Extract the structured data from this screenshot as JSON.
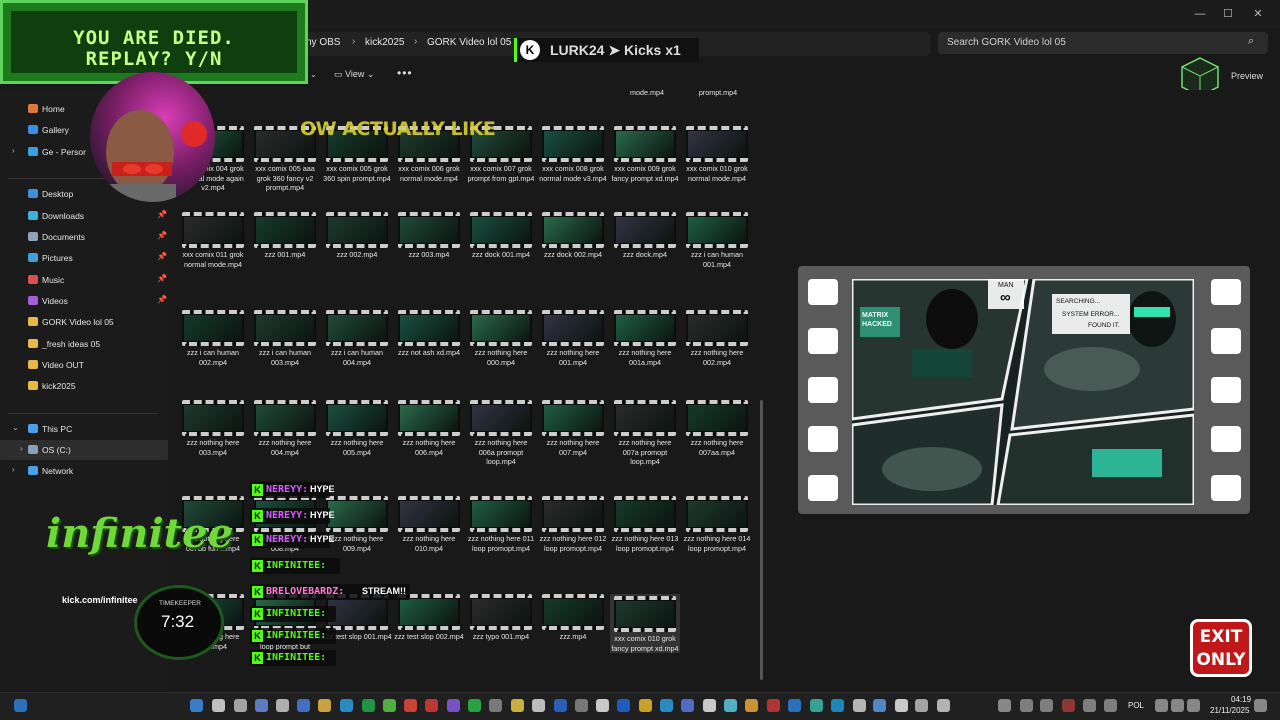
{
  "window": {
    "minimize": "—",
    "maximize": "☐",
    "close": "✕"
  },
  "address": {
    "crumbs": [
      "ny OBS",
      "kick2025",
      "GORK Video lol 05"
    ],
    "separator": "›"
  },
  "search": {
    "placeholder": "Search GORK Video lol 05"
  },
  "toolbar": {
    "view_label": "View",
    "more_label": "•••",
    "preview_label": "Preview"
  },
  "sidebar": {
    "items": [
      {
        "label": "Home",
        "color": "#e07a3c"
      },
      {
        "label": "Gallery",
        "color": "#3c8ee0"
      },
      {
        "label": "Ge - Persor",
        "color": "#3c9ee0"
      },
      {
        "label": "Desktop",
        "color": "#3f8fd9"
      },
      {
        "label": "Downloads",
        "color": "#3fb0d9"
      },
      {
        "label": "Documents",
        "color": "#8fa3b8"
      },
      {
        "label": "Pictures",
        "color": "#3fa0d9"
      },
      {
        "label": "Music",
        "color": "#d95050"
      },
      {
        "label": "Videos",
        "color": "#a75fd9"
      },
      {
        "label": "GORK Video lol 05",
        "color": "#e8b84a"
      },
      {
        "label": "_fresh ideas 05",
        "color": "#e8b84a"
      },
      {
        "label": "Video OUT",
        "color": "#e8b84a"
      },
      {
        "label": "kick2025",
        "color": "#e8b84a"
      },
      {
        "label": "This PC",
        "color": "#4aa0e8"
      },
      {
        "label": "OS (C:)",
        "color": "#8aa0b8"
      },
      {
        "label": "Network",
        "color": "#4aa0e8"
      }
    ]
  },
  "files": {
    "top_cut": [
      "mode.mp4",
      "prompt.mp4"
    ],
    "rows": [
      [
        "xxx comix 004 grok normal mode again v2.mp4",
        "xxx comix 005 aaa grok 360 fancy v2 prompt.mp4",
        "xxx comix 005 grok 360 spin prompt.mp4",
        "xxx comix 006 grok normal mode.mp4",
        "xxx comix 007 grok prompt from gpt.mp4",
        "xxx comix 008 grok normal mode v3.mp4",
        "xxx comix 009 grok fancy prompt xd.mp4",
        "xxx comix 010 grok normal mode.mp4"
      ],
      [
        "xxx comix 011 grok normal mode.mp4",
        "zzz 001.mp4",
        "zzz 002.mp4",
        "zzz 003.mp4",
        "zzz dock 001.mp4",
        "zzz dock 002.mp4",
        "zzz dock.mp4",
        "zzz i can human 001.mp4"
      ],
      [
        "zzz i can human 002.mp4",
        "zzz i can human 003.mp4",
        "zzz i can human 004.mp4",
        "zzz not ash xd.mp4",
        "zzz nothing here 000.mp4",
        "zzz nothing here 001.mp4",
        "zzz nothing here 001a.mp4",
        "zzz nothing here 002.mp4"
      ],
      [
        "zzz nothing here 003.mp4",
        "zzz nothing here 004.mp4",
        "zzz nothing here 005.mp4",
        "zzz nothing here 006.mp4",
        "zzz nothing here 006a promopt loop.mp4",
        "zzz nothing here 007.mp4",
        "zzz nothing here 007a promopt loop.mp4",
        "zzz nothing here 007aa.mp4"
      ],
      [
        "zzz nothing here 007bb fun ...mp4",
        "zzz nothing here 008.mp4",
        "zzz nothing here 009.mp4",
        "zzz nothing here 010.mp4",
        "zzz nothing here 011 loop promopt.mp4",
        "zzz nothing here 012 loop promopt.mp4",
        "zzz nothing here 013 loop promopt.mp4",
        "zzz nothing here 014 loop promopt.mp4"
      ],
      [
        "zzz nothing here 015.mp4",
        "zzz nothing here 016 loop prompt but",
        "zzz test slop 001.mp4",
        "zzz test slop 002.mp4",
        "zzz typo 001.mp4",
        "zzz.mp4",
        "xxx comix 010 grok fancy prompt xd.mp4",
        ""
      ]
    ]
  },
  "overlay": {
    "game_line1": "YOU ARE DIED.",
    "game_line2": "REPLAY? Y/N",
    "lurk": "LURK24 ➤ Kicks x1",
    "kick_letter": "K",
    "caption": "OW ACTUALLY LIKE",
    "logo": "infinitee",
    "kick_url": "kick.com/infinitee",
    "timer_label": "TIMEKEEPER",
    "timer_value": "7:32",
    "exit_line1": "EXIT",
    "exit_line2": "ONLY",
    "chat": [
      {
        "name": "NEREYY:",
        "color": "#d65cff",
        "msg": "HYPE"
      },
      {
        "name": "NEREYY:",
        "color": "#d65cff",
        "msg": "HYPE"
      },
      {
        "name": "NEREYY:",
        "color": "#d65cff",
        "msg": "HYPE"
      },
      {
        "name": "INFINITEE:",
        "color": "#53fc18",
        "msg": ""
      },
      {
        "name": "BRELOVEBARDZ:",
        "color": "#ff7ad9",
        "msg": "STREAM!!"
      },
      {
        "name": "INFINITEE:",
        "color": "#53fc18",
        "msg": ""
      },
      {
        "name": "INFINITEE:",
        "color": "#53fc18",
        "msg": ""
      },
      {
        "name": "INFINITEE:",
        "color": "#53fc18",
        "msg": ""
      }
    ]
  },
  "preview": {
    "comic_captions": [
      "MAN",
      "∞",
      "SEARCHING...",
      "SYSTEM ERROR...",
      "FOUND IT.",
      "MATRIX HACKED"
    ]
  },
  "taskbar": {
    "language": "POL",
    "time": "04:19",
    "date": "21/11/2025"
  }
}
